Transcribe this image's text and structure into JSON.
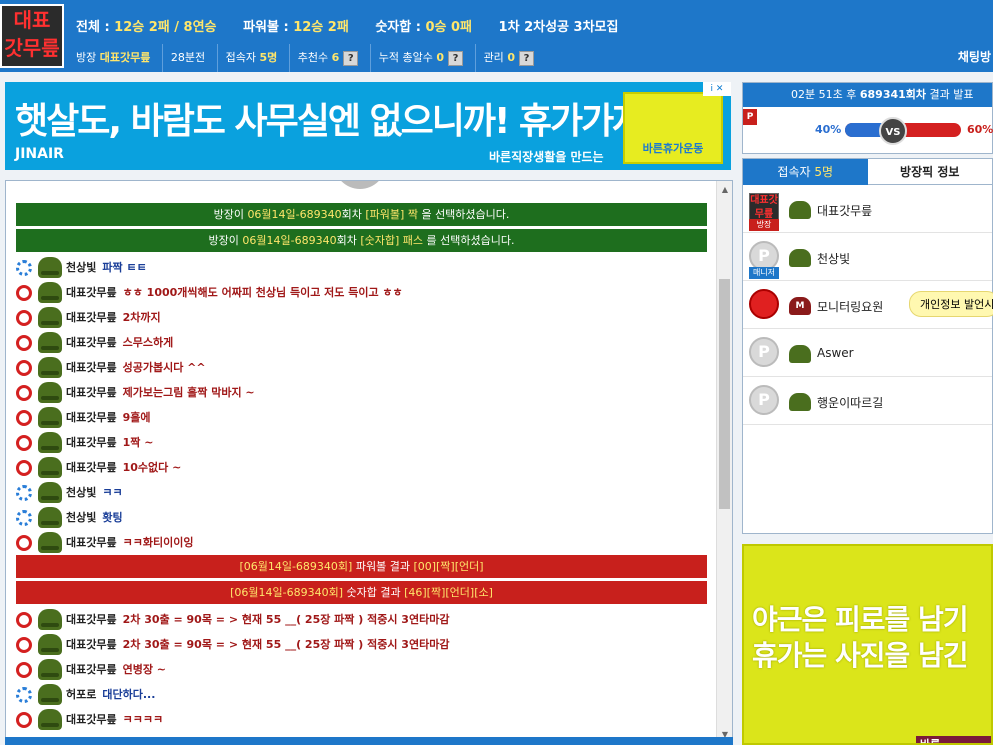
{
  "header": {
    "logo_line1": "대표",
    "logo_line2": "갓무릎",
    "stats": [
      {
        "label": "전체 : ",
        "value": "12승 2패 / 8연승"
      },
      {
        "label": "파워볼 : ",
        "value": "12승 2패"
      },
      {
        "label": "숫자합 : ",
        "value": "0승 0패"
      },
      {
        "label": "",
        "value": "1차 2차성공 3차모집"
      }
    ],
    "host_label": "방장",
    "host_name": "대표갓무릎",
    "elapsed": "28분전",
    "viewers_label": "접속자",
    "viewers_count": "5명",
    "recommend_label": "추천수",
    "recommend_count": "6",
    "gift_label": "누적 총알수",
    "gift_count": "0",
    "manage_label": "관리",
    "manage_count": "0",
    "help_symbol": "?",
    "chatroom_label": "채팅방"
  },
  "ad_top": {
    "headline": "햇살도, 바람도 사무실엔 없으니까! 휴가가자!",
    "brand": "JINAIR",
    "subline": "바른직장생활을 만드는",
    "badge": "바른휴가운동",
    "info": "i ✕"
  },
  "chat": {
    "system_top": [
      {
        "prefix": "방장이 ",
        "date": "06월14일-689340",
        "mid": "회차 ",
        "pick": "[파워볼] 짝",
        "suffix": " 을 선택하셨습니다."
      },
      {
        "prefix": "방장이 ",
        "date": "06월14일-689340",
        "mid": "회차 ",
        "pick": "[숫자합] 패스",
        "suffix": " 를 선택하셨습니다."
      }
    ],
    "messages_a": [
      {
        "icon": "blue",
        "nick": "천상빛",
        "text": "파짝 ㅌㅌ",
        "color": "blue"
      },
      {
        "icon": "red",
        "nick": "대표갓무릎",
        "text": "ㅎㅎ 1000개씩해도 어짜피 천상님 득이고 저도 득이고 ㅎㅎ",
        "color": "red"
      },
      {
        "icon": "red",
        "nick": "대표갓무릎",
        "text": "2차까지",
        "color": "red"
      },
      {
        "icon": "red",
        "nick": "대표갓무릎",
        "text": "스무스하게",
        "color": "red"
      },
      {
        "icon": "red",
        "nick": "대표갓무릎",
        "text": "성공가봅시다 ^^",
        "color": "red"
      },
      {
        "icon": "red",
        "nick": "대표갓무릎",
        "text": "제가보는그림 홀짝 막바지 ~",
        "color": "red"
      },
      {
        "icon": "red",
        "nick": "대표갓무릎",
        "text": "9홀에",
        "color": "red"
      },
      {
        "icon": "red",
        "nick": "대표갓무릎",
        "text": "1짝 ~",
        "color": "red"
      },
      {
        "icon": "red",
        "nick": "대표갓무릎",
        "text": "10수없다 ~",
        "color": "red"
      },
      {
        "icon": "blue",
        "nick": "천상빛",
        "text": "ㅋㅋ",
        "color": "blue"
      },
      {
        "icon": "blue",
        "nick": "천상빛",
        "text": "홧팅",
        "color": "blue"
      },
      {
        "icon": "red",
        "nick": "대표갓무릎",
        "text": "ㅋㅋ화티이이잉",
        "color": "red"
      }
    ],
    "system_result": [
      {
        "date": "[06월14일-689340회]",
        "label": " 파워볼 결과 ",
        "result": "[00][짝][언더]"
      },
      {
        "date": "[06월14일-689340회]",
        "label": " 숫자합 결과 ",
        "result": "[46][짝][언더][소]"
      }
    ],
    "messages_b": [
      {
        "icon": "red",
        "nick": "대표갓무릎",
        "text": "2차 30출 = 90목 = > 현재 55 __( 25장 파짝 ) 적중시 3연타마감",
        "color": "red"
      },
      {
        "icon": "red",
        "nick": "대표갓무릎",
        "text": "2차 30출 = 90목 = > 현재 55 __( 25장 파짝 ) 적중시 3연타마감",
        "color": "red"
      },
      {
        "icon": "red",
        "nick": "대표갓무릎",
        "text": "연병장 ~",
        "color": "red"
      },
      {
        "icon": "blue",
        "nick": "허포로",
        "text": "대단하다...",
        "color": "blue"
      },
      {
        "icon": "red",
        "nick": "대표갓무릎",
        "text": "ㅋㅋㅋㅋ",
        "color": "red"
      }
    ]
  },
  "result": {
    "header_time": "02분 51초 후",
    "header_round": "689341회차",
    "header_suffix": "결과 발표",
    "p_badge": "P",
    "left_pct": "40%",
    "right_pct": "60%",
    "left_fraction": 0.4,
    "vs": "VS"
  },
  "users": {
    "tab_viewers_label": "접속자",
    "tab_viewers_count": "5명",
    "tab_pick_label": "방장픽 정보",
    "list": [
      {
        "avatar": "대표갓무릎",
        "tag": "방장",
        "rank": "",
        "name": "대표갓무릎"
      },
      {
        "avatar": "P",
        "tag": "매니저",
        "rank": "",
        "name": "천상빛"
      },
      {
        "avatar": "",
        "tag": "",
        "rank": "M",
        "name": "모니터링요원",
        "tip": "개인정보 발언시"
      },
      {
        "avatar": "P",
        "tag": "",
        "rank": "",
        "name": "Aswer"
      },
      {
        "avatar": "P",
        "tag": "",
        "rank": "",
        "name": "행운이따르길"
      }
    ]
  },
  "ad_side": {
    "line1": "야근은 피로를 남기",
    "line2": "휴가는 사진을 남긴",
    "foot": "바른"
  }
}
